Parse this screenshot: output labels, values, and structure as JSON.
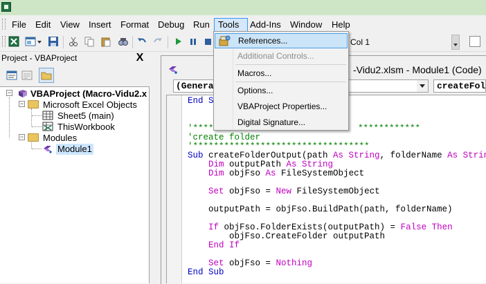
{
  "menubar": {
    "items": [
      {
        "label": "File"
      },
      {
        "label": "Edit"
      },
      {
        "label": "View"
      },
      {
        "label": "Insert"
      },
      {
        "label": "Format"
      },
      {
        "label": "Debug"
      },
      {
        "label": "Run"
      },
      {
        "label": "Tools"
      },
      {
        "label": "Add-Ins"
      },
      {
        "label": "Window"
      },
      {
        "label": "Help"
      }
    ]
  },
  "toolbar": {
    "cursor_position": "Col 1"
  },
  "project_explorer": {
    "title": "Project - VBAProject",
    "close_glyph": "X",
    "tree": {
      "project": "VBAProject (Macro-Vidu2.x",
      "folder_objects": "Microsoft Excel Objects",
      "sheet": "Sheet5 (main)",
      "workbook": "ThisWorkbook",
      "folder_modules": "Modules",
      "module": "Module1"
    }
  },
  "code_window": {
    "title": "-Vidu2.xlsm - Module1 (Code)",
    "object_combo": "(General",
    "procedure_combo": "createFold",
    "lines": {
      "l0_kw": "End Su",
      "l1": "'*******",
      "l1_tail": "************",
      "l2": "'create folder",
      "l3": "'**********************************",
      "l4_kw": "Sub ",
      "l4_a": "createFolderOutput(path ",
      "l4_as1": "As String",
      "l4_b": ", folderName ",
      "l4_as2": "As String",
      "l4_c": ")",
      "l5_kw": "    Dim ",
      "l5_a": "outputPath ",
      "l5_as": "As String",
      "l6_kw": "    Dim ",
      "l6_a": "objFso ",
      "l6_as": "As ",
      "l6_b": "FileSystemObject",
      "l7_kw": "    Set ",
      "l7_a": "objFso = ",
      "l7_new": "New ",
      "l7_b": "FileSystemObject",
      "l8": "    outputPath = objFso.BuildPath(path, folderName)",
      "l9_kw": "    If ",
      "l9_a": "objFso.FolderExists(outputPath) = ",
      "l9_false": "False ",
      "l9_then": "Then",
      "l10": "        objFso.CreateFolder outputPath",
      "l11_kw": "    End If",
      "l12_kw": "    Set ",
      "l12_a": "objFso = ",
      "l12_nothing": "Nothing",
      "l13_kw": "End Sub"
    }
  },
  "tools_menu": {
    "references": "References...",
    "additional_controls": "Additional Controls...",
    "macros": "Macros...",
    "options": "Options...",
    "properties": "VBAProject Properties...",
    "digital_signature": "Digital Signature..."
  },
  "colors": {
    "keyword": "#0000c0",
    "keyword_alt": "#c000c0",
    "comment": "#008000",
    "highlight": "#cce4f7"
  }
}
